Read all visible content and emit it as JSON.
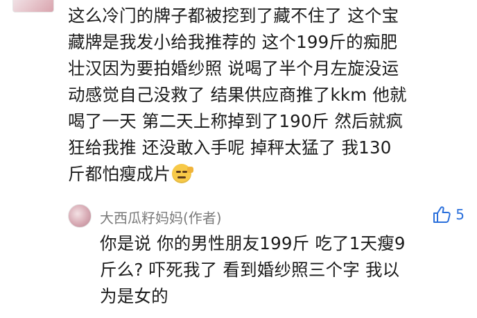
{
  "comment": {
    "lines": [
      "这么冷门的牌子都被挖到了藏不住了 这个宝",
      "藏牌是我发小给我推荐的 这个199斤的痴肥",
      "壮汉因为要拍婚纱照 说喝了半个月左旋没运",
      "动感觉自己没救了 结果供应商推了kkm 他就",
      "喝了一天 第二天上称掉到了190斤 然后就疯",
      "狂给我推 还没敢入手呢 掉秤太猛了 我130",
      "斤都怕瘦成片"
    ],
    "trailing_emoji": "flushed-sweat-emoji"
  },
  "reply": {
    "author": "大西瓜籽妈妈(作者)",
    "like_count": "5",
    "like_icon": "thumbs-up-icon",
    "accent_color": "#2a6fdb",
    "lines": [
      "你是说 你的男性朋友199斤 吃了1天瘦9",
      "斤么? 吓死我了 看到婚纱照三个字 我以",
      "为是女的"
    ]
  }
}
